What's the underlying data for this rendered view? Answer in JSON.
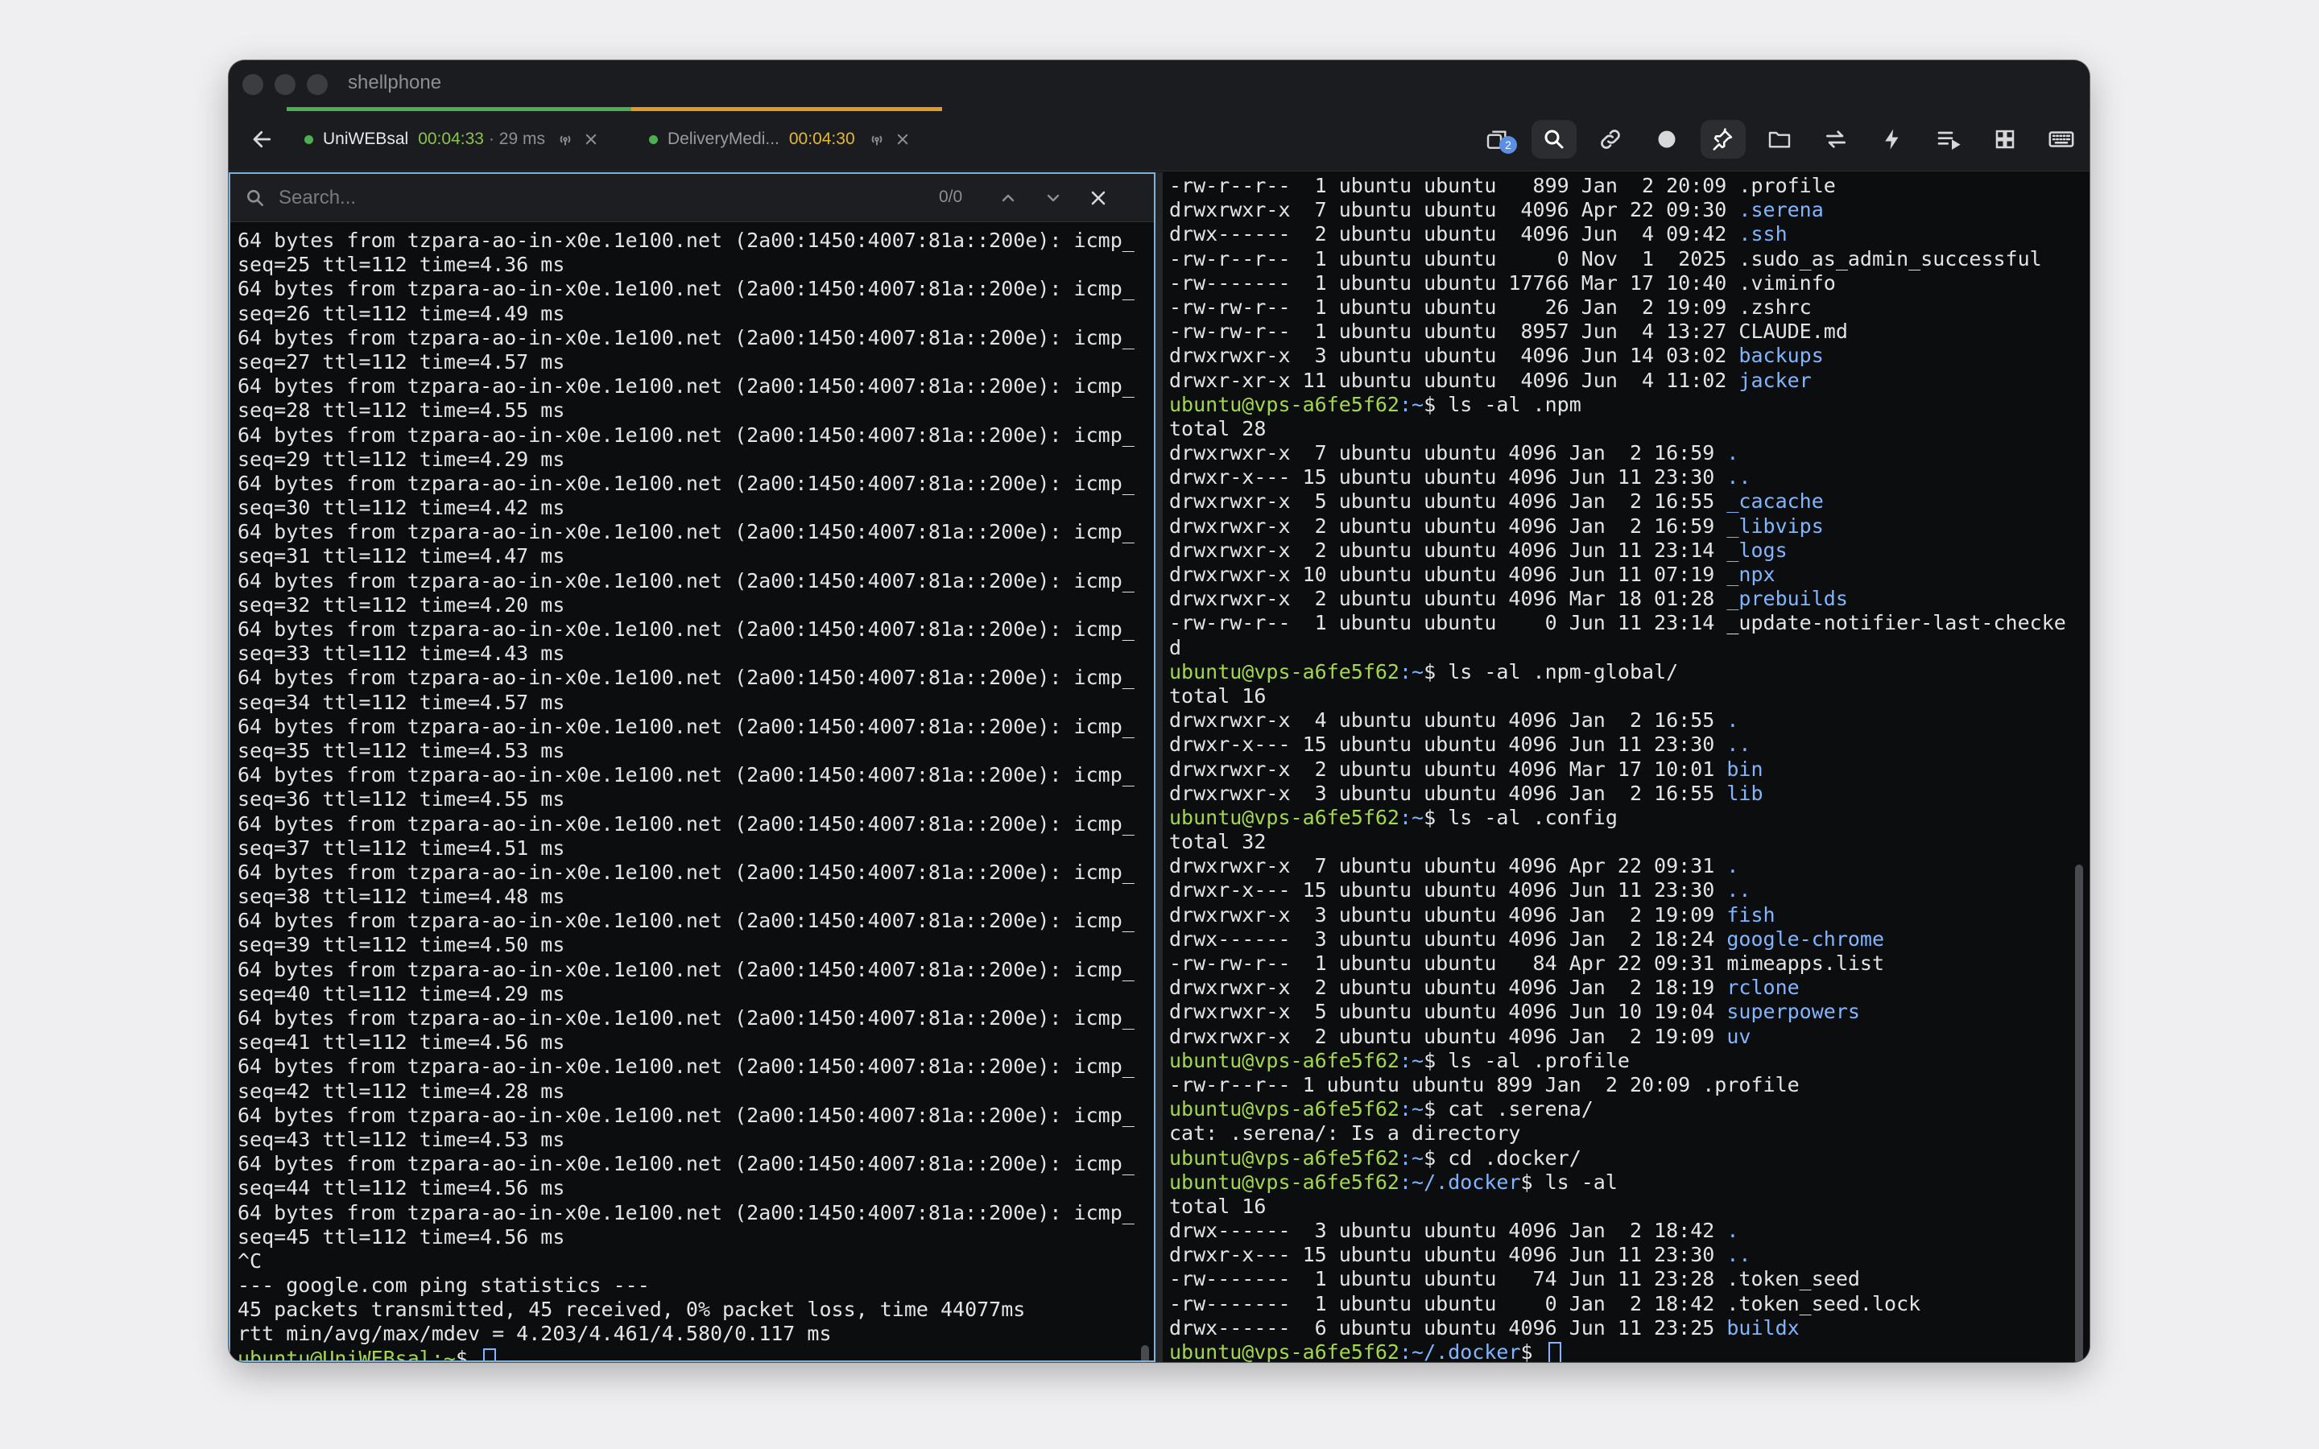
{
  "app": {
    "title": "shellphone"
  },
  "tabs": [
    {
      "name": "UniWEBsal",
      "time": "00:04:33",
      "latency": "· 29 ms",
      "status_color": "#4caf50",
      "bar_color": "#4caf50"
    },
    {
      "name": "DeliveryMedi...",
      "time": "00:04:30",
      "latency": "",
      "status_color": "#4caf50",
      "bar_color": "#e59a26"
    }
  ],
  "toolbar": {
    "badge_count": "2",
    "icons": [
      "layers-icon",
      "search-icon",
      "link-icon",
      "record-icon",
      "pin-icon",
      "folder-icon",
      "transfer-icon",
      "bolt-icon",
      "list-play-icon",
      "grid-icon",
      "keyboard-icon"
    ]
  },
  "search": {
    "placeholder": "Search...",
    "count": "0/0"
  },
  "left_lines": [
    "64 bytes from tzpara-ao-in-x0e.1e100.net (2a00:1450:4007:81a::200e): icmp_",
    "seq=25 ttl=112 time=4.36 ms",
    "64 bytes from tzpara-ao-in-x0e.1e100.net (2a00:1450:4007:81a::200e): icmp_",
    "seq=26 ttl=112 time=4.49 ms",
    "64 bytes from tzpara-ao-in-x0e.1e100.net (2a00:1450:4007:81a::200e): icmp_",
    "seq=27 ttl=112 time=4.57 ms",
    "64 bytes from tzpara-ao-in-x0e.1e100.net (2a00:1450:4007:81a::200e): icmp_",
    "seq=28 ttl=112 time=4.55 ms",
    "64 bytes from tzpara-ao-in-x0e.1e100.net (2a00:1450:4007:81a::200e): icmp_",
    "seq=29 ttl=112 time=4.29 ms",
    "64 bytes from tzpara-ao-in-x0e.1e100.net (2a00:1450:4007:81a::200e): icmp_",
    "seq=30 ttl=112 time=4.42 ms",
    "64 bytes from tzpara-ao-in-x0e.1e100.net (2a00:1450:4007:81a::200e): icmp_",
    "seq=31 ttl=112 time=4.47 ms",
    "64 bytes from tzpara-ao-in-x0e.1e100.net (2a00:1450:4007:81a::200e): icmp_",
    "seq=32 ttl=112 time=4.20 ms",
    "64 bytes from tzpara-ao-in-x0e.1e100.net (2a00:1450:4007:81a::200e): icmp_",
    "seq=33 ttl=112 time=4.43 ms",
    "64 bytes from tzpara-ao-in-x0e.1e100.net (2a00:1450:4007:81a::200e): icmp_",
    "seq=34 ttl=112 time=4.57 ms",
    "64 bytes from tzpara-ao-in-x0e.1e100.net (2a00:1450:4007:81a::200e): icmp_",
    "seq=35 ttl=112 time=4.53 ms",
    "64 bytes from tzpara-ao-in-x0e.1e100.net (2a00:1450:4007:81a::200e): icmp_",
    "seq=36 ttl=112 time=4.55 ms",
    "64 bytes from tzpara-ao-in-x0e.1e100.net (2a00:1450:4007:81a::200e): icmp_",
    "seq=37 ttl=112 time=4.51 ms",
    "64 bytes from tzpara-ao-in-x0e.1e100.net (2a00:1450:4007:81a::200e): icmp_",
    "seq=38 ttl=112 time=4.48 ms",
    "64 bytes from tzpara-ao-in-x0e.1e100.net (2a00:1450:4007:81a::200e): icmp_",
    "seq=39 ttl=112 time=4.50 ms",
    "64 bytes from tzpara-ao-in-x0e.1e100.net (2a00:1450:4007:81a::200e): icmp_",
    "seq=40 ttl=112 time=4.29 ms",
    "64 bytes from tzpara-ao-in-x0e.1e100.net (2a00:1450:4007:81a::200e): icmp_",
    "seq=41 ttl=112 time=4.56 ms",
    "64 bytes from tzpara-ao-in-x0e.1e100.net (2a00:1450:4007:81a::200e): icmp_",
    "seq=42 ttl=112 time=4.28 ms",
    "64 bytes from tzpara-ao-in-x0e.1e100.net (2a00:1450:4007:81a::200e): icmp_",
    "seq=43 ttl=112 time=4.53 ms",
    "64 bytes from tzpara-ao-in-x0e.1e100.net (2a00:1450:4007:81a::200e): icmp_",
    "seq=44 ttl=112 time=4.56 ms",
    "64 bytes from tzpara-ao-in-x0e.1e100.net (2a00:1450:4007:81a::200e): icmp_",
    "seq=45 ttl=112 time=4.56 ms",
    "^C",
    "--- google.com ping statistics ---",
    "45 packets transmitted, 45 received, 0% packet loss, time 44077ms",
    "rtt min/avg/max/mdev = 4.203/4.461/4.580/0.117 ms"
  ],
  "left_prompt": {
    "prompt": "ubuntu@UniWEBsal:~",
    "suffix": "$ "
  },
  "right_lines": [
    {
      "t": "-rw-r--r--  1 ubuntu ubuntu   899 Jan  2 20:09 ",
      "n": ".profile",
      "k": "f"
    },
    {
      "t": "drwxrwxr-x  7 ubuntu ubuntu  4096 Apr 22 09:30 ",
      "n": ".serena",
      "k": "d"
    },
    {
      "t": "drwx------  2 ubuntu ubuntu  4096 Jun  4 09:42 ",
      "n": ".ssh",
      "k": "d"
    },
    {
      "t": "-rw-r--r--  1 ubuntu ubuntu     0 Nov  1  2025 ",
      "n": ".sudo_as_admin_successful",
      "k": "f"
    },
    {
      "t": "-rw-------  1 ubuntu ubuntu 17766 Mar 17 10:40 ",
      "n": ".viminfo",
      "k": "f"
    },
    {
      "t": "-rw-rw-r--  1 ubuntu ubuntu    26 Jan  2 19:09 ",
      "n": ".zshrc",
      "k": "f"
    },
    {
      "t": "-rw-rw-r--  1 ubuntu ubuntu  8957 Jun  4 13:27 ",
      "n": "CLAUDE.md",
      "k": "f"
    },
    {
      "t": "drwxrwxr-x  3 ubuntu ubuntu  4096 Jun 14 03:02 ",
      "n": "backups",
      "k": "d"
    },
    {
      "t": "drwxr-xr-x 11 ubuntu ubuntu  4096 Jun  4 11:02 ",
      "n": "jacker",
      "k": "d"
    },
    {
      "t": "",
      "p": "ubuntu@vps-a6fe5f62",
      "cwd": ":~",
      "cmd": "$ ls -al .npm",
      "k": "p"
    },
    {
      "t": "total 28",
      "n": "",
      "k": "f"
    },
    {
      "t": "drwxrwxr-x  7 ubuntu ubuntu 4096 Jan  2 16:59 ",
      "n": ".",
      "k": "d"
    },
    {
      "t": "drwxr-x--- 15 ubuntu ubuntu 4096 Jun 11 23:30 ",
      "n": "..",
      "k": "d"
    },
    {
      "t": "drwxrwxr-x  5 ubuntu ubuntu 4096 Jan  2 16:55 ",
      "n": "_cacache",
      "k": "d"
    },
    {
      "t": "drwxrwxr-x  2 ubuntu ubuntu 4096 Jan  2 16:59 ",
      "n": "_libvips",
      "k": "d"
    },
    {
      "t": "drwxrwxr-x  2 ubuntu ubuntu 4096 Jun 11 23:14 ",
      "n": "_logs",
      "k": "d"
    },
    {
      "t": "drwxrwxr-x 10 ubuntu ubuntu 4096 Jun 11 07:19 ",
      "n": "_npx",
      "k": "d"
    },
    {
      "t": "drwxrwxr-x  2 ubuntu ubuntu 4096 Mar 18 01:28 ",
      "n": "_prebuilds",
      "k": "d"
    },
    {
      "t": "-rw-rw-r--  1 ubuntu ubuntu    0 Jun 11 23:14 ",
      "n": "_update-notifier-last-checke",
      "k": "f"
    },
    {
      "t": "d",
      "n": "",
      "k": "f"
    },
    {
      "t": "",
      "p": "ubuntu@vps-a6fe5f62",
      "cwd": ":~",
      "cmd": "$ ls -al .npm-global/",
      "k": "p"
    },
    {
      "t": "total 16",
      "n": "",
      "k": "f"
    },
    {
      "t": "drwxrwxr-x  4 ubuntu ubuntu 4096 Jan  2 16:55 ",
      "n": ".",
      "k": "d"
    },
    {
      "t": "drwxr-x--- 15 ubuntu ubuntu 4096 Jun 11 23:30 ",
      "n": "..",
      "k": "d"
    },
    {
      "t": "drwxrwxr-x  2 ubuntu ubuntu 4096 Mar 17 10:01 ",
      "n": "bin",
      "k": "d"
    },
    {
      "t": "drwxrwxr-x  3 ubuntu ubuntu 4096 Jan  2 16:55 ",
      "n": "lib",
      "k": "d"
    },
    {
      "t": "",
      "p": "ubuntu@vps-a6fe5f62",
      "cwd": ":~",
      "cmd": "$ ls -al .config",
      "k": "p"
    },
    {
      "t": "total 32",
      "n": "",
      "k": "f"
    },
    {
      "t": "drwxrwxr-x  7 ubuntu ubuntu 4096 Apr 22 09:31 ",
      "n": ".",
      "k": "d"
    },
    {
      "t": "drwxr-x--- 15 ubuntu ubuntu 4096 Jun 11 23:30 ",
      "n": "..",
      "k": "d"
    },
    {
      "t": "drwxrwxr-x  3 ubuntu ubuntu 4096 Jan  2 19:09 ",
      "n": "fish",
      "k": "d"
    },
    {
      "t": "drwx------  3 ubuntu ubuntu 4096 Jan  2 18:24 ",
      "n": "google-chrome",
      "k": "d"
    },
    {
      "t": "-rw-rw-r--  1 ubuntu ubuntu   84 Apr 22 09:31 ",
      "n": "mimeapps.list",
      "k": "f"
    },
    {
      "t": "drwxrwxr-x  2 ubuntu ubuntu 4096 Jan  2 18:19 ",
      "n": "rclone",
      "k": "d"
    },
    {
      "t": "drwxrwxr-x  5 ubuntu ubuntu 4096 Jun 10 19:04 ",
      "n": "superpowers",
      "k": "d"
    },
    {
      "t": "drwxrwxr-x  2 ubuntu ubuntu 4096 Jan  2 19:09 ",
      "n": "uv",
      "k": "d"
    },
    {
      "t": "",
      "p": "ubuntu@vps-a6fe5f62",
      "cwd": ":~",
      "cmd": "$ ls -al .profile",
      "k": "p"
    },
    {
      "t": "-rw-r--r-- 1 ubuntu ubuntu 899 Jan  2 20:09 .profile",
      "n": "",
      "k": "f"
    },
    {
      "t": "",
      "p": "ubuntu@vps-a6fe5f62",
      "cwd": ":~",
      "cmd": "$ cat .serena/",
      "k": "p"
    },
    {
      "t": "cat: .serena/: Is a directory",
      "n": "",
      "k": "f"
    },
    {
      "t": "",
      "p": "ubuntu@vps-a6fe5f62",
      "cwd": ":~",
      "cmd": "$ cd .docker/",
      "k": "p"
    },
    {
      "t": "",
      "p": "ubuntu@vps-a6fe5f62",
      "cwd": ":~/.docker",
      "cmd": "$ ls -al",
      "k": "p"
    },
    {
      "t": "total 16",
      "n": "",
      "k": "f"
    },
    {
      "t": "drwx------  3 ubuntu ubuntu 4096 Jan  2 18:42 ",
      "n": ".",
      "k": "d"
    },
    {
      "t": "drwxr-x--- 15 ubuntu ubuntu 4096 Jun 11 23:30 ",
      "n": "..",
      "k": "d"
    },
    {
      "t": "-rw-------  1 ubuntu ubuntu   74 Jun 11 23:28 ",
      "n": ".token_seed",
      "k": "f"
    },
    {
      "t": "-rw-------  1 ubuntu ubuntu    0 Jan  2 18:42 ",
      "n": ".token_seed.lock",
      "k": "f"
    },
    {
      "t": "drwx------  6 ubuntu ubuntu 4096 Jun 11 23:25 ",
      "n": "buildx",
      "k": "d"
    }
  ],
  "right_prompt": {
    "prompt": "ubuntu@vps-a6fe5f62",
    "cwd": ":~/.docker",
    "suffix": "$ "
  }
}
